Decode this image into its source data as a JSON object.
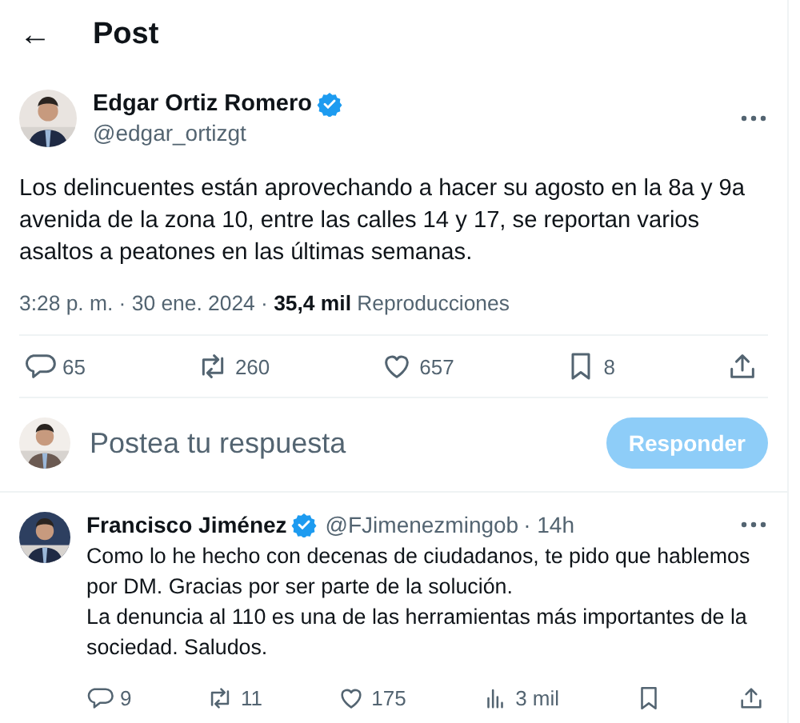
{
  "header": {
    "back_icon": "←",
    "title": "Post"
  },
  "post": {
    "author": {
      "name": "Edgar Ortiz Romero",
      "verified": true,
      "handle": "@edgar_ortizgt"
    },
    "text": "Los delincuentes están aprovechando a hacer su agosto en la 8a y 9a avenida de la zona 10, entre las calles 14 y 17, se reportan varios asaltos a peatones en las últimas semanas.",
    "meta": "3:28 p. m. · 30 ene. 2024 · **35,4 mil** Reproducciones",
    "actions": [
      {
        "kind": "reply",
        "count": "65"
      },
      {
        "kind": "repost",
        "count": "260"
      },
      {
        "kind": "like",
        "count": "657"
      },
      {
        "kind": "bookmark",
        "count": "8"
      },
      {
        "kind": "share"
      }
    ]
  },
  "composer": {
    "placeholder": "Postea tu respuesta",
    "button": "Responder",
    "disabled": true
  },
  "replies": [
    {
      "name": "Francisco Jiménez",
      "verified": true,
      "handle": "@FJimenezmingob",
      "time": "· 14h",
      "paragraphs": [
        "Como lo he hecho con decenas de ciudadanos, te pido que hablemos por DM. Gracias por ser parte de la solución.",
        "La denuncia al 110 es una de las herramientas más importantes de la sociedad. Saludos."
      ],
      "actions": [
        {
          "kind": "reply",
          "count": "9"
        },
        {
          "kind": "repost",
          "count": "11"
        },
        {
          "kind": "like",
          "count": "175"
        },
        {
          "kind": "views",
          "count": "3 mil"
        },
        {
          "kind": "bookmark"
        },
        {
          "kind": "share"
        }
      ]
    }
  ]
}
